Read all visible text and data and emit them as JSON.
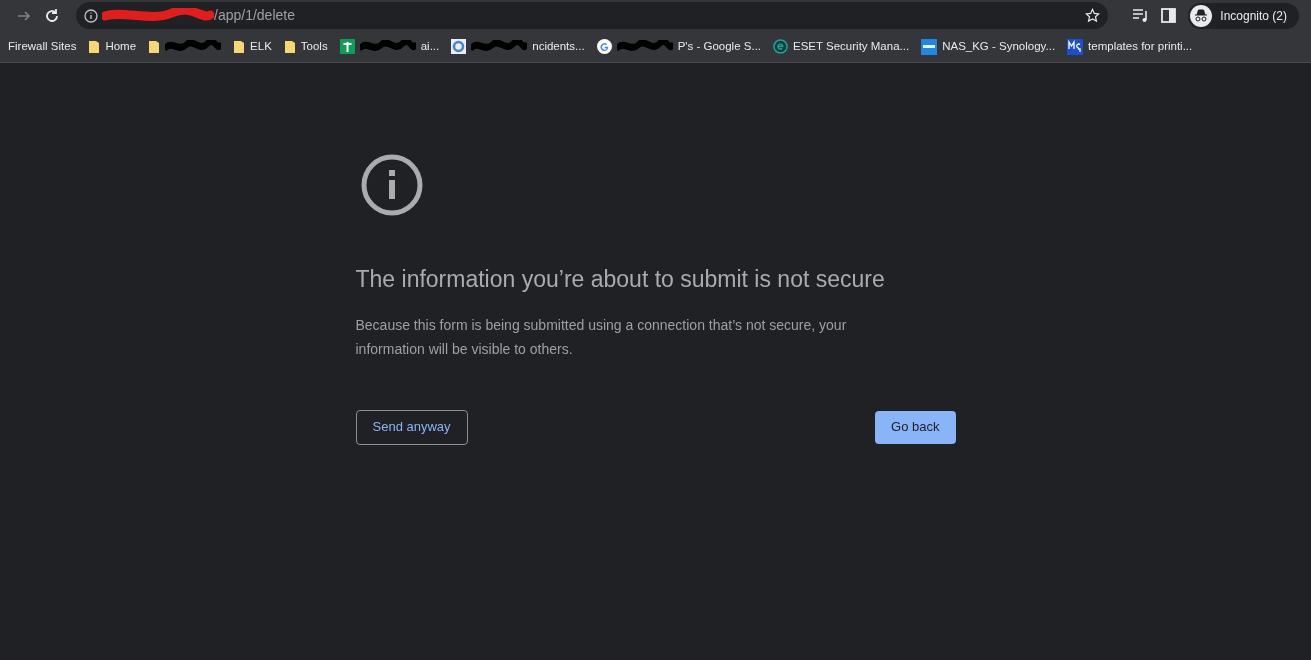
{
  "address_bar": {
    "url": "/app/1/delete"
  },
  "profile": {
    "label": "Incognito (2)"
  },
  "bookmarks": [
    {
      "kind": "text",
      "label": "Firewall Sites"
    },
    {
      "kind": "folder",
      "label": "Home"
    },
    {
      "kind": "folder",
      "redacted": true
    },
    {
      "kind": "folder",
      "label": "ELK"
    },
    {
      "kind": "folder",
      "label": "Tools"
    },
    {
      "kind": "sheets",
      "label": "ai...",
      "redacted": true
    },
    {
      "kind": "circle",
      "label": "ncidents...",
      "redacted": true
    },
    {
      "kind": "google",
      "label": "P's - Google S...",
      "redacted": true
    },
    {
      "kind": "eset",
      "label": "ESET Security Mana..."
    },
    {
      "kind": "dsm",
      "label": "NAS_KG - Synology..."
    },
    {
      "kind": "mg",
      "label": "templates for printi..."
    }
  ],
  "warning": {
    "title": "The information you’re about to submit is not secure",
    "body": "Because this form is being submitted using a connection that’s not secure, your information will be visible to others.",
    "buttons": [
      {
        "label": "Send anyway",
        "primary": false
      },
      {
        "label": "Go back",
        "primary": true
      }
    ]
  }
}
